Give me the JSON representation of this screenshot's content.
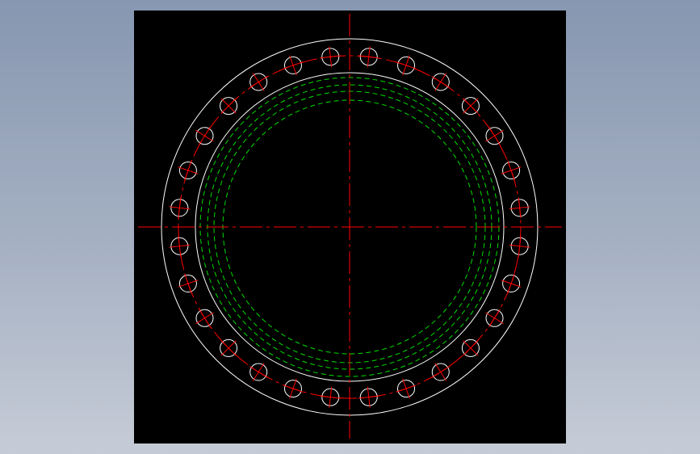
{
  "colors": {
    "background_top": "#8797b1",
    "background_bottom": "#c6ccd7",
    "viewport": "#000000",
    "outline": "#ffffff",
    "centerline": "#ff0000",
    "hidden_line": "#00dd00"
  },
  "flange": {
    "bolt_hole_count": 28,
    "line_types": [
      "continuous",
      "center",
      "hidden"
    ]
  }
}
